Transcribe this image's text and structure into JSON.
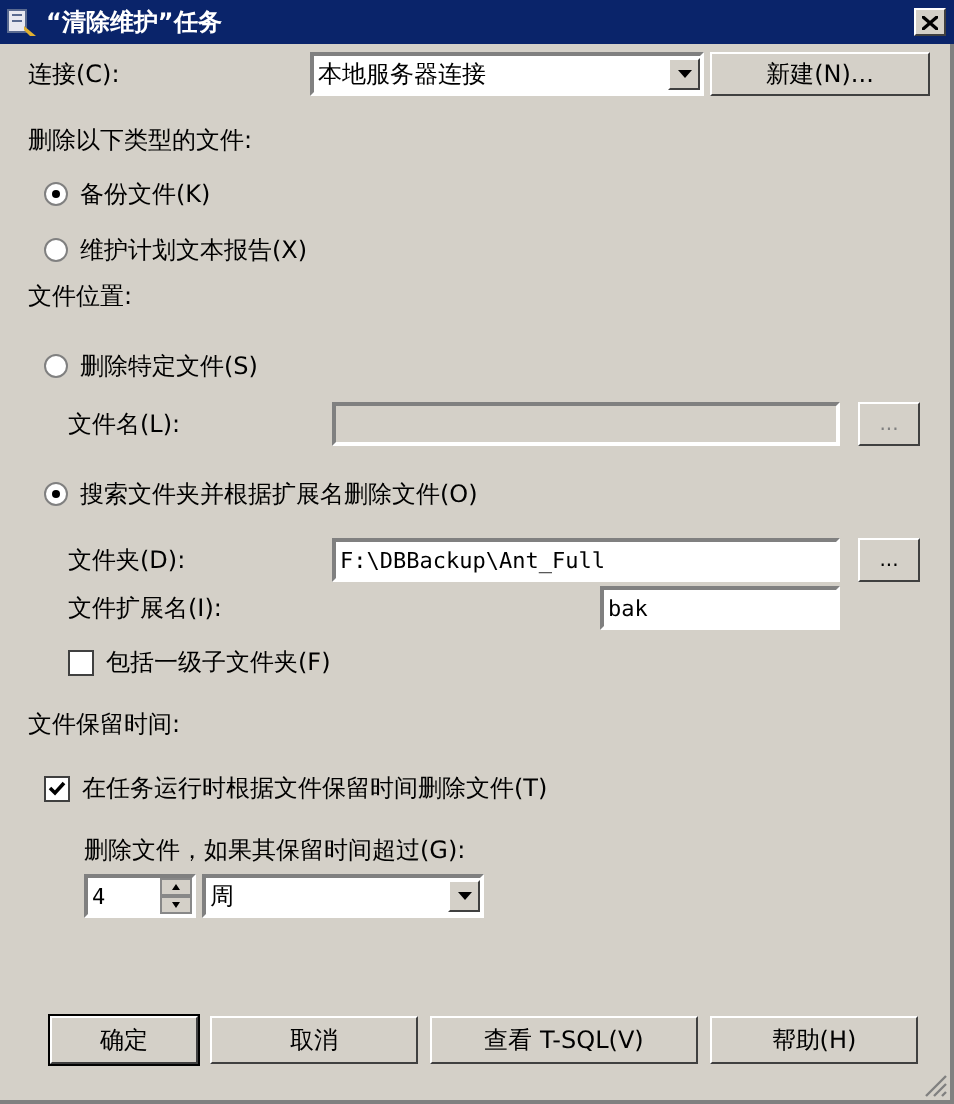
{
  "window": {
    "title": "“清除维护”任务"
  },
  "rows": [
    {
      "kind": "combo",
      "label": "连接(C):",
      "value": "本地服务器连接",
      "button": "新建(N)..."
    },
    {
      "kind": "heading",
      "label": "删除以下类型的文件:"
    },
    {
      "kind": "radio",
      "label": "备份文件(K)",
      "selected": true
    },
    {
      "kind": "radio",
      "label": "维护计划文本报告(X)",
      "selected": false
    },
    {
      "kind": "heading",
      "label": "文件位置:"
    },
    {
      "kind": "radio",
      "label": "删除特定文件(S)",
      "selected": false
    },
    {
      "kind": "field",
      "label": "文件名(L):",
      "disabled": true,
      "browse": "..."
    },
    {
      "kind": "radio",
      "label": "搜索文件夹并根据扩展名删除文件(O)",
      "selected": true
    },
    {
      "kind": "field",
      "label": "文件夹(D):",
      "value": "F:\\DBBackup\\Ant_Full",
      "disabled": false,
      "browse": "..."
    },
    {
      "kind": "short-field",
      "label": "文件扩展名(I):",
      "value": "bak"
    },
    {
      "kind": "sub-checkbox",
      "label": "包括一级子文件夹(F)",
      "checked": false
    },
    {
      "kind": "heading",
      "label": "文件保留时间:"
    },
    {
      "kind": "checkbox",
      "label": "在任务运行时根据文件保留时间删除文件(T)",
      "checked": true
    },
    {
      "kind": "sub-label",
      "label": "删除文件，如果其保留时间超过(G):"
    },
    {
      "kind": "spin-combo",
      "number": "4",
      "unit": "周"
    }
  ],
  "buttons": [
    "确定",
    "取消",
    "查看 T-SQL(V)",
    "帮助(H)"
  ]
}
